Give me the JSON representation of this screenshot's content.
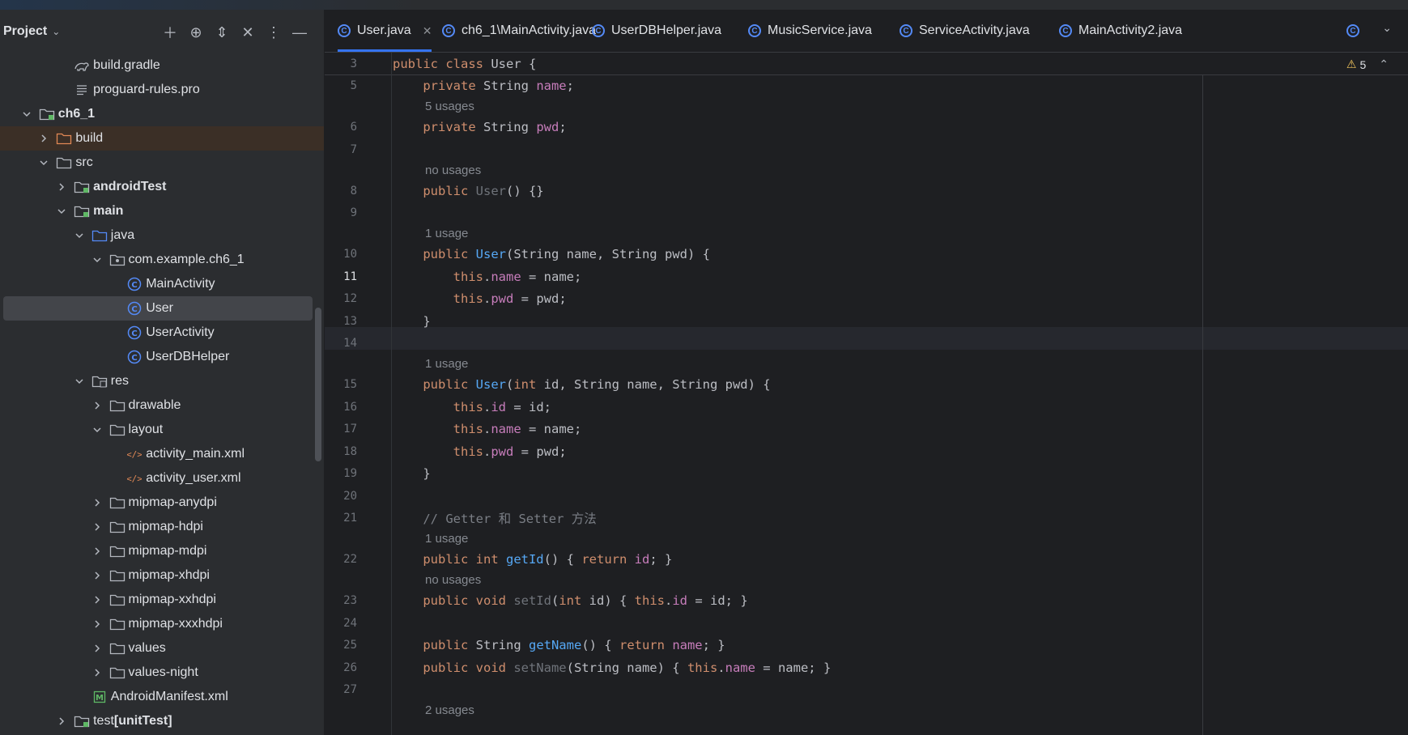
{
  "panel": {
    "title": "Project",
    "tree": [
      {
        "label": "build.gradle",
        "icon": "gradle-icon",
        "indent": 3,
        "arrow": "none"
      },
      {
        "label": "proguard-rules.pro",
        "icon": "text-file-icon",
        "indent": 3,
        "arrow": "none"
      },
      {
        "label": "ch6_1",
        "icon": "module-folder-icon",
        "indent": 1,
        "arrow": "down",
        "bold": true
      },
      {
        "label": "build",
        "icon": "folder-orange-icon",
        "indent": 2,
        "arrow": "right",
        "highlight": "orange"
      },
      {
        "label": "src",
        "icon": "folder-icon",
        "indent": 2,
        "arrow": "down"
      },
      {
        "label": "androidTest",
        "icon": "test-folder-icon",
        "indent": 3,
        "arrow": "right",
        "bold": true
      },
      {
        "label": "main",
        "icon": "source-folder-icon",
        "indent": 3,
        "arrow": "down",
        "bold": true
      },
      {
        "label": "java",
        "icon": "folder-blue-icon",
        "indent": 4,
        "arrow": "down"
      },
      {
        "label": "com.example.ch6_1",
        "icon": "package-icon",
        "indent": 5,
        "arrow": "down"
      },
      {
        "label": "MainActivity",
        "icon": "class-icon",
        "indent": 6,
        "arrow": "none"
      },
      {
        "label": "User",
        "icon": "class-icon",
        "indent": 6,
        "arrow": "none",
        "selected": true
      },
      {
        "label": "UserActivity",
        "icon": "class-icon",
        "indent": 6,
        "arrow": "none"
      },
      {
        "label": "UserDBHelper",
        "icon": "class-icon",
        "indent": 6,
        "arrow": "none"
      },
      {
        "label": "res",
        "icon": "res-folder-icon",
        "indent": 4,
        "arrow": "down"
      },
      {
        "label": "drawable",
        "icon": "folder-icon",
        "indent": 5,
        "arrow": "right"
      },
      {
        "label": "layout",
        "icon": "folder-icon",
        "indent": 5,
        "arrow": "down"
      },
      {
        "label": "activity_main.xml",
        "icon": "xml-icon",
        "indent": 6,
        "arrow": "none"
      },
      {
        "label": "activity_user.xml",
        "icon": "xml-icon",
        "indent": 6,
        "arrow": "none"
      },
      {
        "label": "mipmap-anydpi",
        "icon": "folder-icon",
        "indent": 5,
        "arrow": "right"
      },
      {
        "label": "mipmap-hdpi",
        "icon": "folder-icon",
        "indent": 5,
        "arrow": "right"
      },
      {
        "label": "mipmap-mdpi",
        "icon": "folder-icon",
        "indent": 5,
        "arrow": "right"
      },
      {
        "label": "mipmap-xhdpi",
        "icon": "folder-icon",
        "indent": 5,
        "arrow": "right"
      },
      {
        "label": "mipmap-xxhdpi",
        "icon": "folder-icon",
        "indent": 5,
        "arrow": "right"
      },
      {
        "label": "mipmap-xxxhdpi",
        "icon": "folder-icon",
        "indent": 5,
        "arrow": "right"
      },
      {
        "label": "values",
        "icon": "folder-icon",
        "indent": 5,
        "arrow": "right"
      },
      {
        "label": "values-night",
        "icon": "folder-icon",
        "indent": 5,
        "arrow": "right"
      },
      {
        "label": "AndroidManifest.xml",
        "icon": "manifest-icon",
        "indent": 4,
        "arrow": "none"
      },
      {
        "label": "test",
        "label_bold_suffix": "[unitTest]",
        "icon": "test-folder-icon",
        "indent": 3,
        "arrow": "right"
      }
    ]
  },
  "tabs": [
    {
      "label": "User.java",
      "active": true,
      "closable": true
    },
    {
      "label": "ch6_1\\MainActivity.java"
    },
    {
      "label": "UserDBHelper.java"
    },
    {
      "label": "MusicService.java"
    },
    {
      "label": "ServiceActivity.java"
    },
    {
      "label": "MainActivity2.java"
    }
  ],
  "editor": {
    "warning_count": "5",
    "lines": [
      {
        "kind": "code",
        "ln": "3",
        "tokens": [
          [
            "kw",
            "public class "
          ],
          [
            "pl",
            "User {"
          ]
        ]
      },
      {
        "kind": "code",
        "ln": "5",
        "tokens": [
          [
            "pl",
            "    "
          ],
          [
            "kw",
            "private "
          ],
          [
            "pl",
            "String "
          ],
          [
            "fld",
            "name"
          ],
          [
            "pl",
            ";"
          ]
        ]
      },
      {
        "kind": "hint",
        "text": "5 usages"
      },
      {
        "kind": "code",
        "ln": "6",
        "tokens": [
          [
            "pl",
            "    "
          ],
          [
            "kw",
            "private "
          ],
          [
            "pl",
            "String "
          ],
          [
            "fld",
            "pwd"
          ],
          [
            "pl",
            ";"
          ]
        ]
      },
      {
        "kind": "code",
        "ln": "7",
        "tokens": []
      },
      {
        "kind": "hint",
        "text": "no usages"
      },
      {
        "kind": "code",
        "ln": "8",
        "tokens": [
          [
            "pl",
            "    "
          ],
          [
            "kw",
            "public "
          ],
          [
            "unused",
            "User"
          ],
          [
            "pl",
            "() {}"
          ]
        ]
      },
      {
        "kind": "code",
        "ln": "9",
        "tokens": []
      },
      {
        "kind": "hint",
        "text": "1 usage"
      },
      {
        "kind": "code",
        "ln": "10",
        "tokens": [
          [
            "pl",
            "    "
          ],
          [
            "kw",
            "public "
          ],
          [
            "fn",
            "User"
          ],
          [
            "pl",
            "(String name, String pwd) {"
          ]
        ]
      },
      {
        "kind": "code",
        "ln": "11",
        "active": true,
        "tokens": [
          [
            "pl",
            "        "
          ],
          [
            "kw",
            "this"
          ],
          [
            "pl",
            "."
          ],
          [
            "fld",
            "name"
          ],
          [
            "pl",
            " = name;"
          ]
        ]
      },
      {
        "kind": "code",
        "ln": "12",
        "tokens": [
          [
            "pl",
            "        "
          ],
          [
            "kw",
            "this"
          ],
          [
            "pl",
            "."
          ],
          [
            "fld",
            "pwd"
          ],
          [
            "pl",
            " = pwd;"
          ]
        ]
      },
      {
        "kind": "code",
        "ln": "13",
        "tokens": [
          [
            "pl",
            "    }"
          ]
        ]
      },
      {
        "kind": "code",
        "ln": "14",
        "tokens": []
      },
      {
        "kind": "hint",
        "text": "1 usage"
      },
      {
        "kind": "code",
        "ln": "15",
        "tokens": [
          [
            "pl",
            "    "
          ],
          [
            "kw",
            "public "
          ],
          [
            "fn",
            "User"
          ],
          [
            "pl",
            "("
          ],
          [
            "kw",
            "int "
          ],
          [
            "pl",
            "id, String name, String pwd) {"
          ]
        ]
      },
      {
        "kind": "code",
        "ln": "16",
        "tokens": [
          [
            "pl",
            "        "
          ],
          [
            "kw",
            "this"
          ],
          [
            "pl",
            "."
          ],
          [
            "fld",
            "id"
          ],
          [
            "pl",
            " = id;"
          ]
        ]
      },
      {
        "kind": "code",
        "ln": "17",
        "tokens": [
          [
            "pl",
            "        "
          ],
          [
            "kw",
            "this"
          ],
          [
            "pl",
            "."
          ],
          [
            "fld",
            "name"
          ],
          [
            "pl",
            " = name;"
          ]
        ]
      },
      {
        "kind": "code",
        "ln": "18",
        "tokens": [
          [
            "pl",
            "        "
          ],
          [
            "kw",
            "this"
          ],
          [
            "pl",
            "."
          ],
          [
            "fld",
            "pwd"
          ],
          [
            "pl",
            " = pwd;"
          ]
        ]
      },
      {
        "kind": "code",
        "ln": "19",
        "tokens": [
          [
            "pl",
            "    }"
          ]
        ]
      },
      {
        "kind": "code",
        "ln": "20",
        "tokens": []
      },
      {
        "kind": "code",
        "ln": "21",
        "tokens": [
          [
            "pl",
            "    "
          ],
          [
            "cmt",
            "// Getter 和 Setter 方法"
          ]
        ]
      },
      {
        "kind": "hint",
        "text": "1 usage"
      },
      {
        "kind": "code",
        "ln": "22",
        "tokens": [
          [
            "pl",
            "    "
          ],
          [
            "kw",
            "public int "
          ],
          [
            "fn",
            "getId"
          ],
          [
            "pl",
            "() { "
          ],
          [
            "kw",
            "return "
          ],
          [
            "fld",
            "id"
          ],
          [
            "pl",
            "; }"
          ]
        ]
      },
      {
        "kind": "hint",
        "text": "no usages"
      },
      {
        "kind": "code",
        "ln": "23",
        "tokens": [
          [
            "pl",
            "    "
          ],
          [
            "kw",
            "public void "
          ],
          [
            "unused",
            "setId"
          ],
          [
            "pl",
            "("
          ],
          [
            "kw",
            "int "
          ],
          [
            "pl",
            "id) { "
          ],
          [
            "kw",
            "this"
          ],
          [
            "pl",
            "."
          ],
          [
            "fld",
            "id"
          ],
          [
            "pl",
            " = id; }"
          ]
        ]
      },
      {
        "kind": "code",
        "ln": "24",
        "tokens": []
      },
      {
        "kind": "code",
        "ln": "25",
        "tokens": [
          [
            "pl",
            "    "
          ],
          [
            "kw",
            "public "
          ],
          [
            "pl",
            "String "
          ],
          [
            "fn",
            "getName"
          ],
          [
            "pl",
            "() { "
          ],
          [
            "kw",
            "return "
          ],
          [
            "fld",
            "name"
          ],
          [
            "pl",
            "; }"
          ]
        ]
      },
      {
        "kind": "code",
        "ln": "26",
        "tokens": [
          [
            "pl",
            "    "
          ],
          [
            "kw",
            "public void "
          ],
          [
            "unused",
            "setName"
          ],
          [
            "pl",
            "(String name) { "
          ],
          [
            "kw",
            "this"
          ],
          [
            "pl",
            "."
          ],
          [
            "fld",
            "name"
          ],
          [
            "pl",
            " = name; }"
          ]
        ]
      },
      {
        "kind": "code",
        "ln": "27",
        "tokens": []
      },
      {
        "kind": "hint",
        "text": "2 usages"
      }
    ]
  },
  "colors": {
    "accent": "#3574f0",
    "keyword": "#cf8e6d",
    "field": "#c77dbb",
    "method": "#56a8f5",
    "background": "#1e1f22",
    "panel": "#2b2d30"
  }
}
